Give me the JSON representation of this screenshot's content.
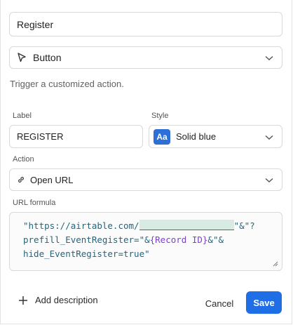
{
  "name_field": {
    "value": "Register"
  },
  "type_select": {
    "value": "Button",
    "icon": "cursor-arrow-icon"
  },
  "type_description": "Trigger a customized action.",
  "label_section": {
    "label": "Label",
    "value": "REGISTER"
  },
  "style_section": {
    "label": "Style",
    "badge": "Aa",
    "value": "Solid blue",
    "badge_color": "#2d6fd8"
  },
  "action_section": {
    "label": "Action",
    "value": "Open URL",
    "icon": "link-icon"
  },
  "formula_section": {
    "label": "URL formula",
    "line1_start": "\"https://airtable.com/",
    "line1_end": "\"&\"?",
    "line2_a": "prefill_EventRegister=\"&",
    "line2_field": "{Record ID}",
    "line2_b": "&\"&",
    "line3": "hide_EventRegister=true\""
  },
  "footer": {
    "add_description": "Add description",
    "cancel": "Cancel",
    "save": "Save",
    "save_color": "#1f6ee5"
  }
}
